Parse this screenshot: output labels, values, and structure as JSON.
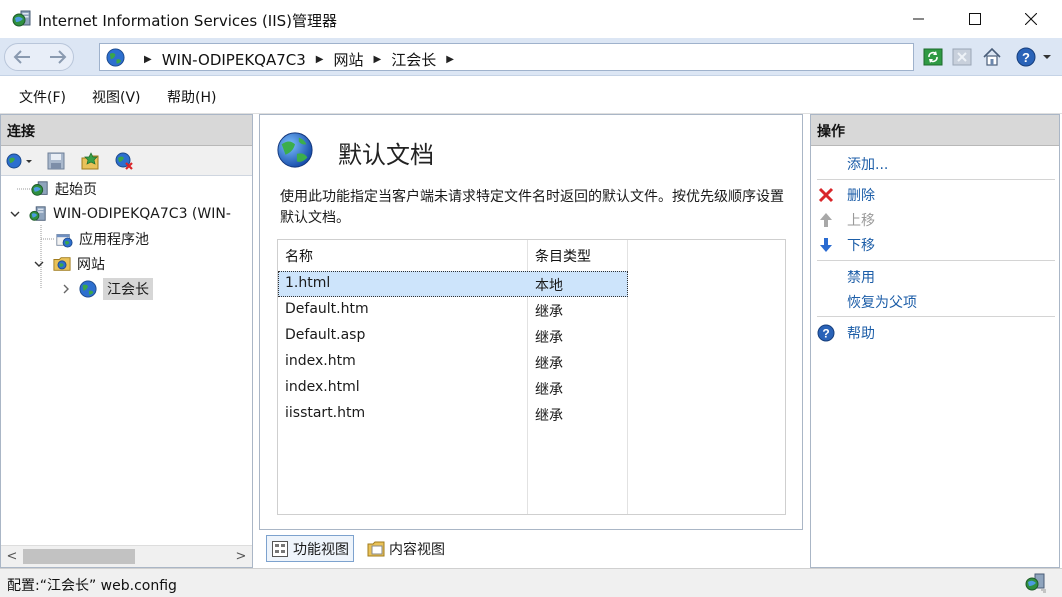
{
  "window": {
    "title": "Internet Information Services (IIS)管理器"
  },
  "address": {
    "breadcrumbs": [
      "WIN-ODIPEKQA7C3",
      "网站",
      "江会长"
    ]
  },
  "menu": {
    "items": [
      "文件(F)",
      "视图(V)",
      "帮助(H)"
    ]
  },
  "connections": {
    "header": "连接",
    "tree": [
      {
        "label": "起始页",
        "icon": "start-page-icon"
      },
      {
        "label": "WIN-ODIPEKQA7C3 (WIN-",
        "icon": "server-icon"
      },
      {
        "label": "应用程序池",
        "icon": "app-pool-icon"
      },
      {
        "label": "网站",
        "icon": "sites-folder-icon"
      },
      {
        "label": "江会长",
        "icon": "website-globe-icon"
      }
    ]
  },
  "feature": {
    "title": "默认文档",
    "description": "使用此功能指定当客户端未请求特定文件名时返回的默认文件。按优先级顺序设置默认文档。",
    "columns": [
      "名称",
      "条目类型"
    ],
    "rows": [
      {
        "name": "1.html",
        "type": "本地",
        "selected": true
      },
      {
        "name": "Default.htm",
        "type": "继承"
      },
      {
        "name": "Default.asp",
        "type": "继承"
      },
      {
        "name": "index.htm",
        "type": "继承"
      },
      {
        "name": "index.html",
        "type": "继承"
      },
      {
        "name": "iisstart.htm",
        "type": "继承"
      }
    ]
  },
  "view_tabs": {
    "features": "功能视图",
    "content": "内容视图"
  },
  "actions": {
    "header": "操作",
    "add": "添加...",
    "remove": "删除",
    "move_up": "上移",
    "move_down": "下移",
    "disable": "禁用",
    "revert": "恢复为父项",
    "help": "帮助"
  },
  "status": {
    "text": "配置:“江会长” web.config"
  },
  "colors": {
    "address_bar_bg": "#dce6f4",
    "selected_row": "#cde4fb",
    "link": "#1d5ea8",
    "remove_red": "#d9262a"
  }
}
